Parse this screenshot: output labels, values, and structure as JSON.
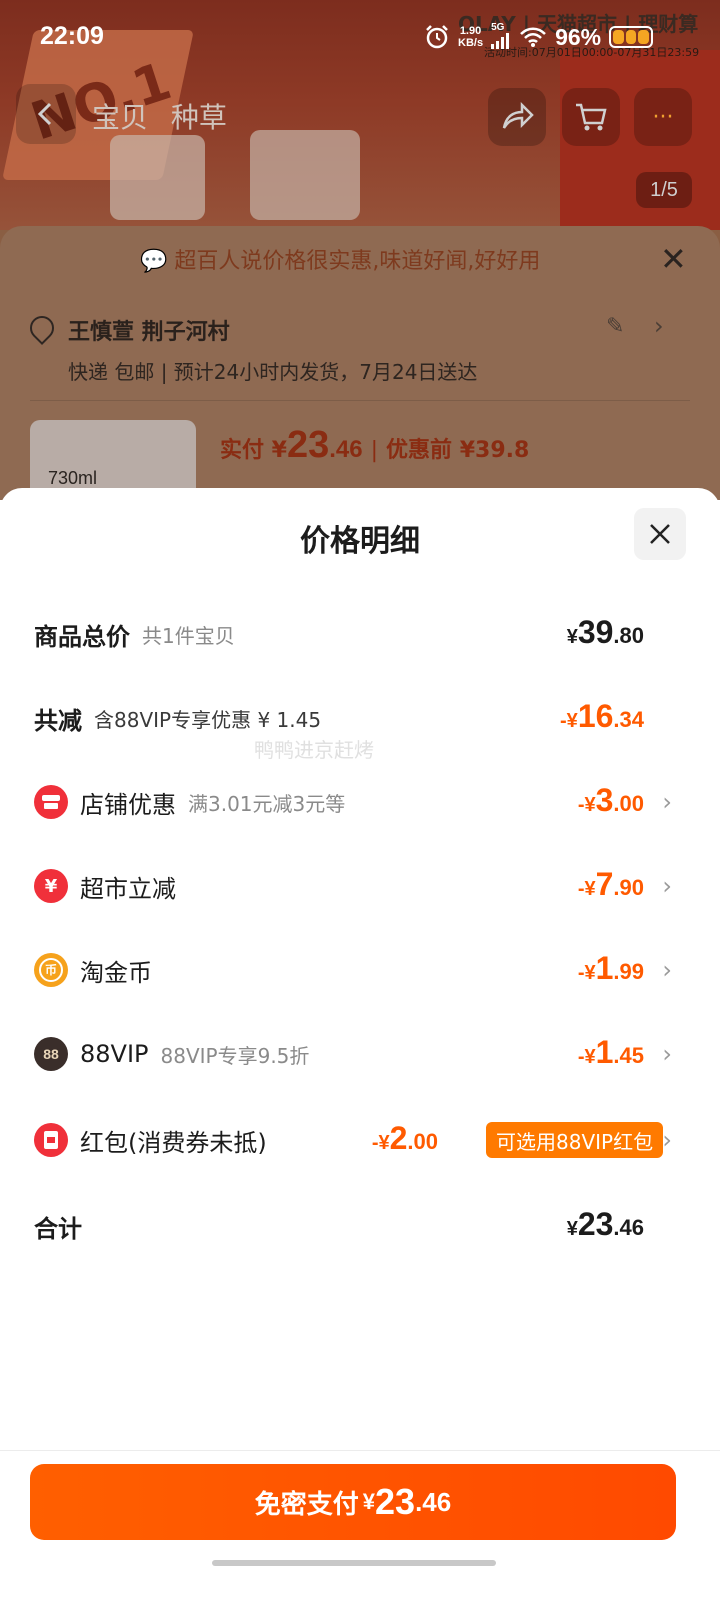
{
  "status_bar": {
    "time": "22:09",
    "net_speed": "1.90",
    "net_unit": "KB/s",
    "signal": "5G",
    "battery": "96%"
  },
  "background": {
    "brand": "OLAY | 天猫超市 | 理财算",
    "activity": "活动时间:07月01日00:00-07月31日23:59",
    "banner_no": "NO.1",
    "nav": {
      "tab1": "宝贝",
      "tab2": "种草",
      "more": "···"
    },
    "pager": "1/5",
    "tip": "超百人说价格很实惠,味道好闻,好好用",
    "address": {
      "name": "王慎萱 荆子河村",
      "delivery": "快递 包邮 | 预计24小时内发货，7月24日送达"
    },
    "thumb_ml": "730ml",
    "price": {
      "label": "实付 ¥",
      "int": "23",
      "dec": ".46",
      "orig": "优惠前 ¥39.8"
    }
  },
  "sheet": {
    "title": "价格明细",
    "watermark": "鸭鸭进京赶烤",
    "rows": [
      {
        "label": "商品总价",
        "sub": "共1件宝贝",
        "cur": "¥",
        "int": "39",
        "dec": ".80"
      },
      {
        "label": "共减",
        "sub": "含88VIP专享优惠 ¥ 1.45",
        "cur": "-¥",
        "int": "16",
        "dec": ".34"
      },
      {
        "label": "店铺优惠",
        "sub": "满3.01元减3元等",
        "cur": "-¥",
        "int": "3",
        "dec": ".00",
        "icon": "shop-icon"
      },
      {
        "label": "超市立减",
        "sub": "",
        "cur": "-¥",
        "int": "7",
        "dec": ".90",
        "icon": "yuan-icon"
      },
      {
        "label": "淘金币",
        "sub": "",
        "cur": "-¥",
        "int": "1",
        "dec": ".99",
        "icon": "coin-icon"
      },
      {
        "label": "88VIP",
        "sub": "88VIP专享9.5折",
        "cur": "-¥",
        "int": "1",
        "dec": ".45",
        "icon": "vip88-icon"
      },
      {
        "label": "红包(消费券未抵)",
        "sub": "",
        "cur": "-¥",
        "int": "2",
        "dec": ".00",
        "tag": "可选用88VIP红包",
        "icon": "red-packet-icon"
      },
      {
        "label": "合计",
        "sub": "",
        "cur": "¥",
        "int": "23",
        "dec": ".46"
      }
    ],
    "pay": {
      "label": "免密支付",
      "cur": "¥",
      "int": "23",
      "dec": ".46"
    }
  },
  "colors": {
    "accent": "#ff5a00",
    "tag_bg": "#ff7a00",
    "icon_red": "#f0303a",
    "icon_gold": "#f6a21c"
  }
}
